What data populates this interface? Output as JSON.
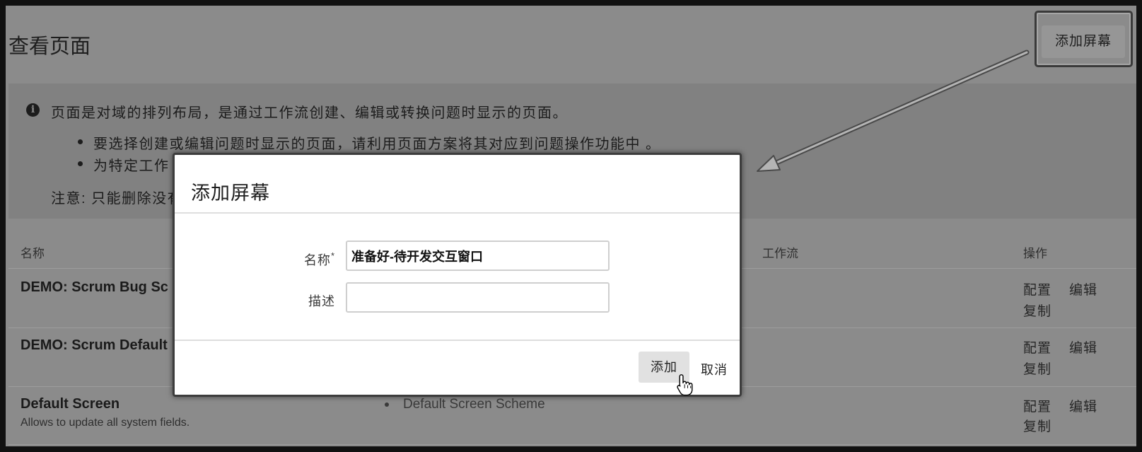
{
  "page": {
    "title": "查看页面",
    "add_screen_button": "添加屏幕"
  },
  "info": {
    "icon": "info-icon",
    "text": "页面是对域的排列布局，是通过工作流创建、编辑或转换问题时显示的页面。",
    "bullets": [
      "要选择创建或编辑问题时显示的页面，请利用页面方案将其对应到问题操作功能中 。",
      "为特定工作"
    ],
    "note": "注意: 只能删除没有"
  },
  "table": {
    "headers": {
      "name": "名称",
      "workflow": "工作流",
      "actions": "操作"
    },
    "rows": [
      {
        "name": "DEMO: Scrum Bug Sc",
        "description": "",
        "scheme": "",
        "actions": [
          "配置",
          "编辑",
          "复制"
        ]
      },
      {
        "name": "DEMO: Scrum Default",
        "description": "",
        "scheme": "",
        "actions": [
          "配置",
          "编辑",
          "复制"
        ]
      },
      {
        "name": "Default Screen",
        "description": "Allows to update all system fields.",
        "scheme": "Default Screen Scheme",
        "actions": [
          "配置",
          "编辑",
          "复制"
        ]
      }
    ]
  },
  "dialog": {
    "title": "添加屏幕",
    "name_label": "名称",
    "required_mark": "*",
    "name_value": "准备好-待开发交互窗口",
    "description_label": "描述",
    "description_value": "",
    "add_button": "添加",
    "cancel_link": "取消"
  },
  "icons": {
    "cursor": "hand-pointer-icon",
    "annotation": "annotation-arrow-icon"
  },
  "colors": {
    "backdrop": "#8b8b8b",
    "info_panel": "#818181",
    "dialog_bg": "#ffffff",
    "dialog_button": "#e1e1e1"
  }
}
